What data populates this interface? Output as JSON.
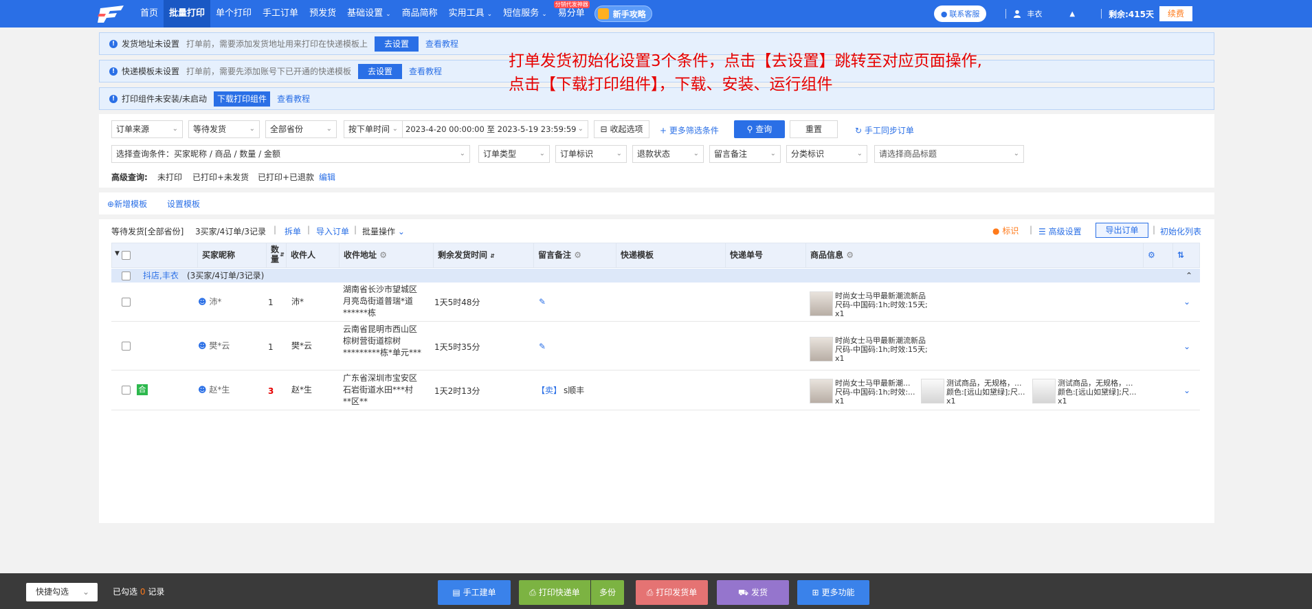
{
  "nav": {
    "items": [
      "首页",
      "批量打印",
      "单个打印",
      "手工订单",
      "预发货",
      "基础设置",
      "商品简称",
      "实用工具",
      "短信服务",
      "易分单"
    ],
    "badge": "分销代发神器",
    "guide": "新手攻略",
    "service": "联系客服",
    "user": "丰衣",
    "remain": "剩余:415天",
    "renew": "续费"
  },
  "notices": [
    {
      "title": "发货地址未设置",
      "desc": "打单前，需要添加发货地址用来打印在快递模板上",
      "button": "去设置",
      "link": "查看教程"
    },
    {
      "title": "快递模板未设置",
      "desc": "打单前，需要先添加账号下已开通的快递模板",
      "button": "去设置",
      "link": "查看教程"
    },
    {
      "title": "打印组件未安装/未启动",
      "button": "下载打印组件",
      "link": "查看教程"
    }
  ],
  "annotation": {
    "line1": "打单发货初始化设置3个条件，点击【去设置】跳转至对应页面操作,",
    "line2": "点击【下载打印组件】，下载、安装、运行组件"
  },
  "filters": {
    "order_source": "订单来源",
    "status": "等待发货",
    "province": "全部省份",
    "time_type": "按下单时间",
    "date_range": "2023-4-20 00:00:00 至 2023-5-19 23:59:59",
    "collapse": "收起选项",
    "more": "+ 更多筛选条件",
    "query": "查询",
    "reset": "重置",
    "sync": "手工同步订单",
    "query_condition": "选择查询条件：买家昵称 / 商品 / 数量 / 金额",
    "order_type": "订单类型",
    "order_flag": "订单标识",
    "refund": "退款状态",
    "remark": "留言备注",
    "category": "分类标识",
    "product_title": "请选择商品标题",
    "advanced_label": "高级查询:",
    "advanced": [
      "未打印",
      "已打印+未发货",
      "已打印+已退款"
    ],
    "edit": "编辑"
  },
  "templates": {
    "add": "新增模板",
    "set": "设置模板"
  },
  "summary": {
    "status": "等待发货[全部省份]",
    "count": "3买家/4订单/3记录",
    "split": "拆单",
    "import": "导入订单",
    "batch": "批量操作",
    "flag": "标识",
    "advanced": "高级设置",
    "export": "导出订单",
    "init": "初始化列表"
  },
  "columns": [
    "买家昵称",
    "数量",
    "收件人",
    "收件地址",
    "剩余发货时间",
    "留言备注",
    "快递模板",
    "快递单号",
    "商品信息"
  ],
  "group": {
    "shop": "抖店,丰衣",
    "count": "(3买家/4订单/3记录)"
  },
  "rows": [
    {
      "buyer": "沛*",
      "qty": "1",
      "receiver": "沛*",
      "address": [
        "湖南省长沙市望城区",
        "月亮岛街道普瑞*道",
        "******栋"
      ],
      "remain": "1天5时48分",
      "remark": "",
      "express": "",
      "products": [
        {
          "name": "时尚女士马甲最新潮流新品",
          "spec": "尺码-中国码:1h;时效:15天;",
          "qty": "x1"
        }
      ]
    },
    {
      "buyer": "樊*云",
      "qty": "1",
      "receiver": "樊*云",
      "address": [
        "云南省昆明市西山区",
        "棕树营街道棕树",
        "*********栋*单元***"
      ],
      "remain": "1天5时35分",
      "remark": "",
      "express": "",
      "products": [
        {
          "name": "时尚女士马甲最新潮流新品",
          "spec": "尺码-中国码:1h;时效:15天;",
          "qty": "x1"
        }
      ]
    },
    {
      "buyer": "赵*生",
      "qty": "3",
      "receiver": "赵*生",
      "merge_tag": "合",
      "address": [
        "广东省深圳市宝安区",
        "石岩街道水田***村",
        "**区**"
      ],
      "remain": "1天2时13分",
      "remark": "【卖】",
      "express": "s顺丰",
      "products": [
        {
          "name": "时尚女士马甲最新潮...",
          "spec": "尺码-中国码:1h;时效:...",
          "qty": "x1"
        },
        {
          "name": "测试商品，无规格，...",
          "spec": "颜色:[远山如黛绿];尺...",
          "qty": "x1"
        },
        {
          "name": "测试商品，无规格，...",
          "spec": "颜色:[远山如黛绿];尺...",
          "qty": "x1"
        }
      ]
    }
  ],
  "bottom": {
    "quick": "快捷勾选",
    "selected_prefix": "已勾选",
    "selected_count": "0",
    "selected_suffix": "记录",
    "manual": "手工建单",
    "print_express": "打印快递单",
    "multi": "多份",
    "print_invoice": "打印发货单",
    "ship": "发货",
    "more": "更多功能"
  },
  "colors": {
    "primary": "#2a6fe6",
    "green": "#7cb342",
    "red": "#e57373",
    "purple": "#9575cd",
    "annotation": "#e60000"
  }
}
